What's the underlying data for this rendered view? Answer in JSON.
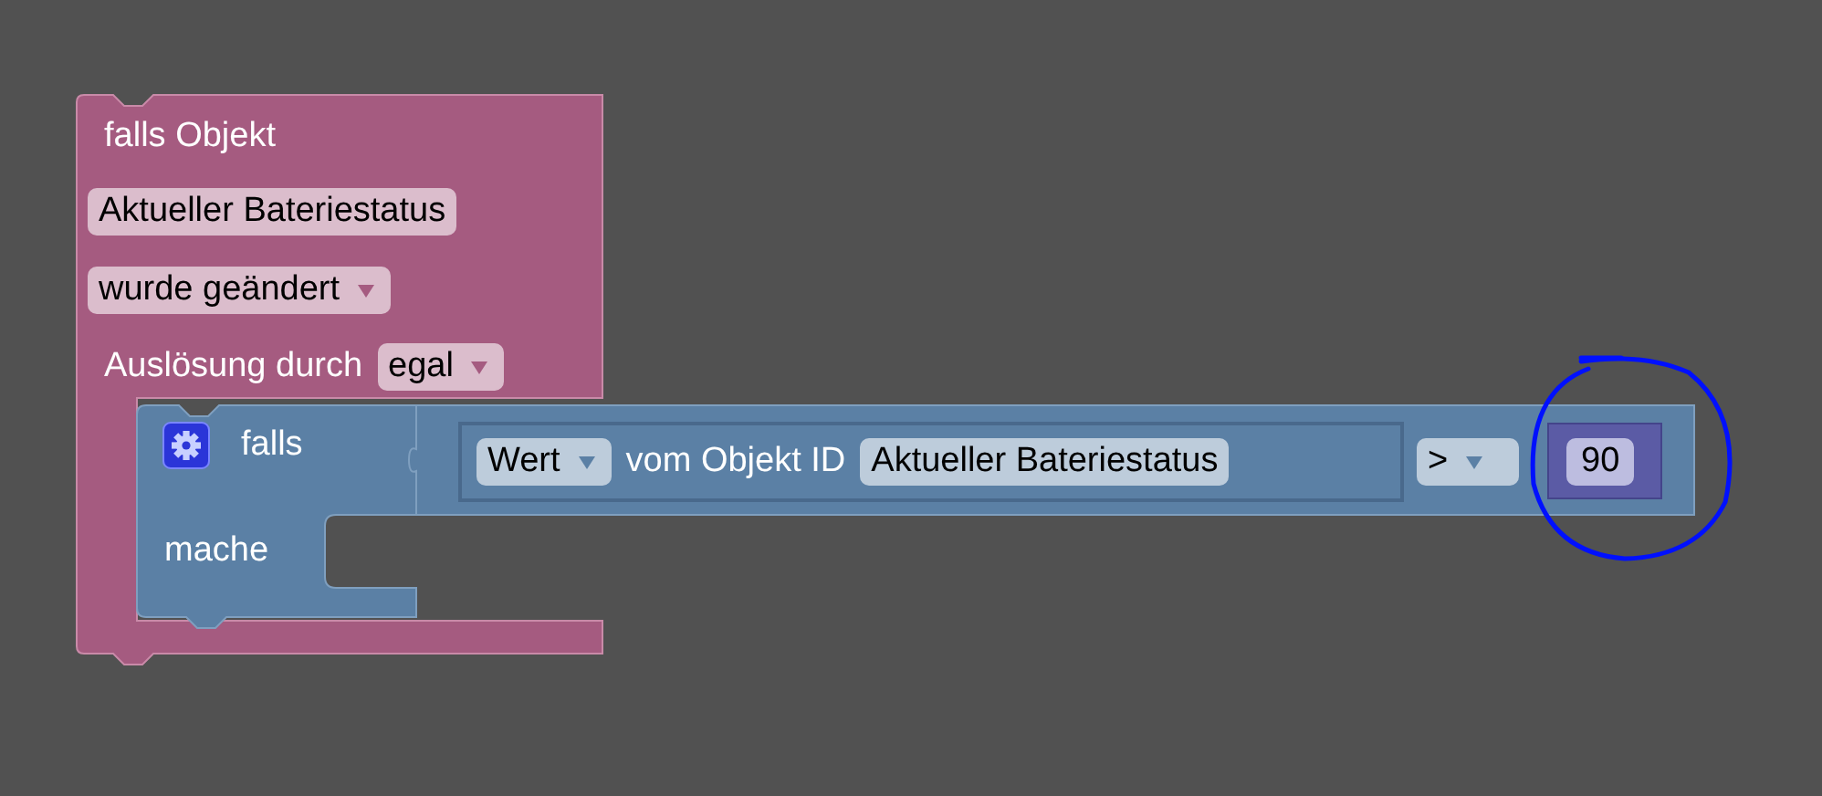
{
  "trigger_block": {
    "title": "falls Objekt",
    "object_field": "Aktueller Bateriestatus",
    "event_dropdown": "wurde geändert",
    "trigger_label": "Auslösung durch",
    "trigger_dropdown": "egal"
  },
  "if_block": {
    "if_label": "falls",
    "do_label": "mache"
  },
  "condition": {
    "value_dropdown": "Wert",
    "object_label": "vom Objekt ID",
    "object_field": "Aktueller Bateriestatus",
    "operator_dropdown": ">",
    "number": "90"
  }
}
